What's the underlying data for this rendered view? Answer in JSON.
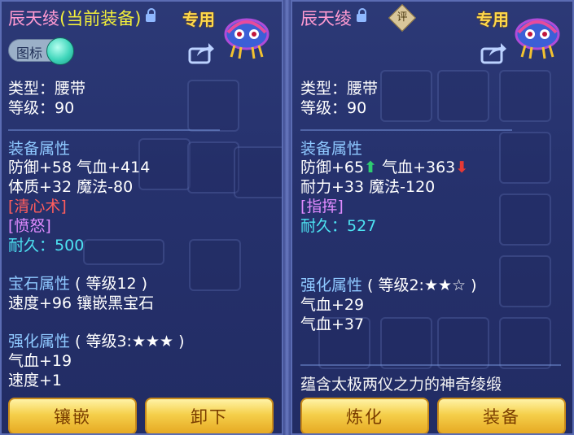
{
  "left": {
    "title_name": "辰天绫",
    "title_status": "(当前装备)",
    "exclusive_badge": "专用",
    "icon_toggle_label": "图标",
    "type_line": "类型：腰带",
    "level_line": "等级：90",
    "equip_attr_heading": "装备属性",
    "attr_line1": "防御+58 气血+414",
    "attr_line2": "体质+32 魔法-80",
    "skill1": "[清心术]",
    "skill2": "[愤怒]",
    "durability_label": "耐久：",
    "durability_value": "500",
    "gem_heading": "宝石属性",
    "gem_level": "( 等级12 )",
    "gem_line": "速度+96 镶嵌黑宝石",
    "enhance_heading": "强化属性",
    "enhance_level": "( 等级3:★★★ )",
    "enhance_line1": "气血+19",
    "enhance_line2": "速度+1",
    "buttons": {
      "inlay": "镶嵌",
      "unequip": "卸下"
    }
  },
  "right": {
    "title_name": "辰天绫",
    "rating_badge": "评",
    "exclusive_badge": "专用",
    "type_line": "类型：腰带",
    "level_line": "等级：90",
    "equip_attr_heading": "装备属性",
    "attr_line1_a": "防御+65",
    "attr_line1_b": "气血+363",
    "attr_line2": "耐力+33 魔法-120",
    "skill1": "[指挥]",
    "durability_label": "耐久：",
    "durability_value": "527",
    "enhance_heading": "强化属性",
    "enhance_level": "( 等级2:★★☆ )",
    "enhance_line1": "气血+29",
    "enhance_line2": "气血+37",
    "description": "蕴含太极两仪之力的神奇绫缎",
    "buttons": {
      "refine": "炼化",
      "equip": "装备"
    }
  },
  "colors": {
    "title": "#ff9ad1",
    "current_tag": "#f2ee3a",
    "section": "#8ec8ff",
    "skill_red": "#ff5d5d",
    "skill_purple": "#e08bff",
    "durability": "#4de3f2",
    "arrow_up": "#2ecc71",
    "arrow_down": "#e53935",
    "button": "#f5cf4a"
  }
}
